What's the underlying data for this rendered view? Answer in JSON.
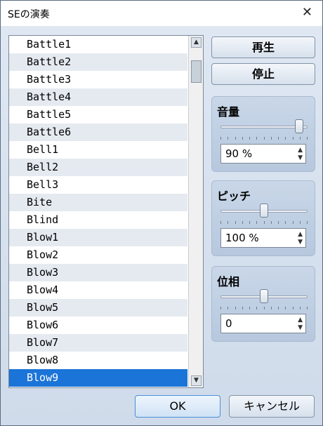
{
  "window": {
    "title": "SEの演奏",
    "close_glyph": "✕"
  },
  "list": {
    "items": [
      "Battle1",
      "Battle2",
      "Battle3",
      "Battle4",
      "Battle5",
      "Battle6",
      "Bell1",
      "Bell2",
      "Bell3",
      "Bite",
      "Blind",
      "Blow1",
      "Blow2",
      "Blow3",
      "Blow4",
      "Blow5",
      "Blow6",
      "Blow7",
      "Blow8",
      "Blow9"
    ],
    "selected": "Blow9",
    "scroll_up_glyph": "▲",
    "scroll_down_glyph": "▼"
  },
  "buttons": {
    "play": "再生",
    "stop": "停止",
    "ok": "OK",
    "cancel": "キャンセル"
  },
  "volume": {
    "label": "音量",
    "value_text": "90 %",
    "slider_fraction": 0.9
  },
  "pitch": {
    "label": "ピッチ",
    "value_text": "100 %",
    "slider_fraction": 0.5
  },
  "pan": {
    "label": "位相",
    "value_text": "0",
    "slider_fraction": 0.5
  },
  "spinner": {
    "up_glyph": "▲",
    "down_glyph": "▼"
  },
  "colors": {
    "selection": "#1b74d8",
    "alt_row": "#e5eaf1",
    "panel": "#c2d1e4"
  }
}
